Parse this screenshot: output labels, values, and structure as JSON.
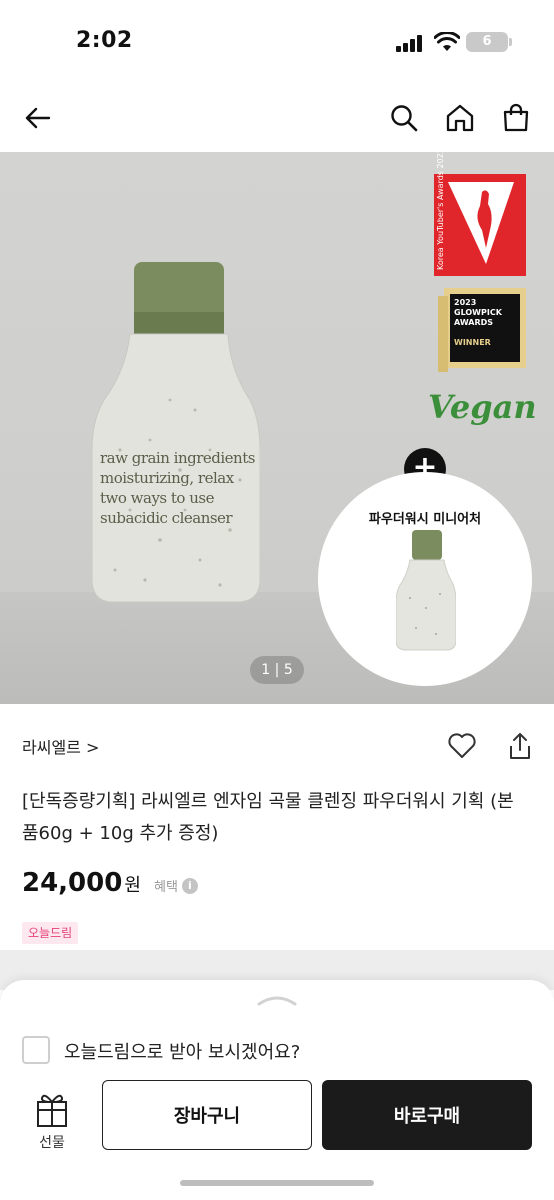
{
  "status_bar": {
    "time": "2:02",
    "battery": "6"
  },
  "nav": {
    "icons": [
      "back-arrow-icon",
      "search-icon",
      "home-icon",
      "shopping-bag-icon"
    ]
  },
  "hero": {
    "bottle_text": [
      "raw grain ingredients",
      "moisturizing, relax",
      "two ways to use",
      "subacidic cleanser"
    ],
    "award_red_text": "Korea YouTuber's Awards 2023",
    "award_glowpick": {
      "line1": "2023",
      "line2": "GLOWPICK",
      "line3": "AWARDS",
      "line4": "WINNER"
    },
    "vegan_text": "Vegan",
    "plus_symbol": "+",
    "mini_title": "파우더워시 미니어처",
    "page_current": "1",
    "page_separator": "|",
    "page_total": "5"
  },
  "product": {
    "brand": "라씨엘르 >",
    "title": "[단독증량기획] 라씨엘르 엔자임 곡물 클렌징 파우더워시 기획 (본품60g + 10g 추가 증정)",
    "price": "24,000",
    "currency": "원",
    "benefit": "혜택",
    "info_symbol": "i",
    "badge": "오늘드림"
  },
  "sheet": {
    "checkbox_label": "오늘드림으로 받아 보시겠어요?",
    "gift_label": "선물",
    "cart_label": "장바구니",
    "buy_label": "바로구매"
  }
}
